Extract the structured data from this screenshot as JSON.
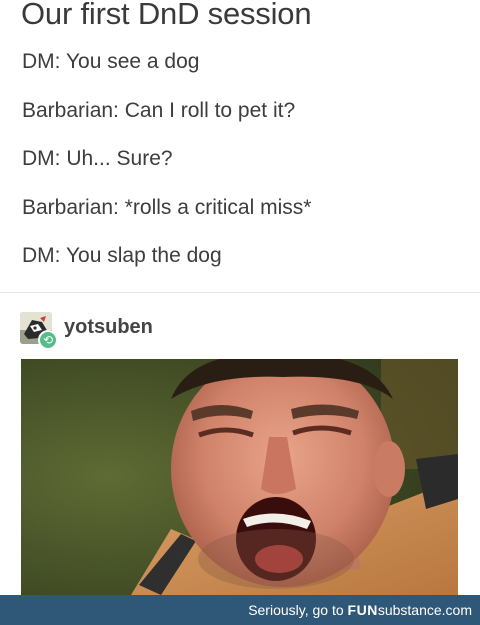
{
  "post": {
    "title": "Our first DnD session",
    "lines": [
      "DM: You see a dog",
      "Barbarian: Can I roll to pet it?",
      "DM: Uh... Sure?",
      "Barbarian: *rolls a critical miss*",
      "DM: You slap the dog"
    ]
  },
  "reblog": {
    "username": "yotsuben",
    "avatar_icon": "cartoon-avatar-icon",
    "badge_icon": "reblog-icon",
    "badge_color": "#56bc8a"
  },
  "image": {
    "icon": "screaming-man-photo"
  },
  "footer": {
    "prefix": "Seriously, go to ",
    "brand_bold": "FUN",
    "brand_rest": "substance",
    "domain": ".com",
    "bar_color": "#2f5878"
  }
}
